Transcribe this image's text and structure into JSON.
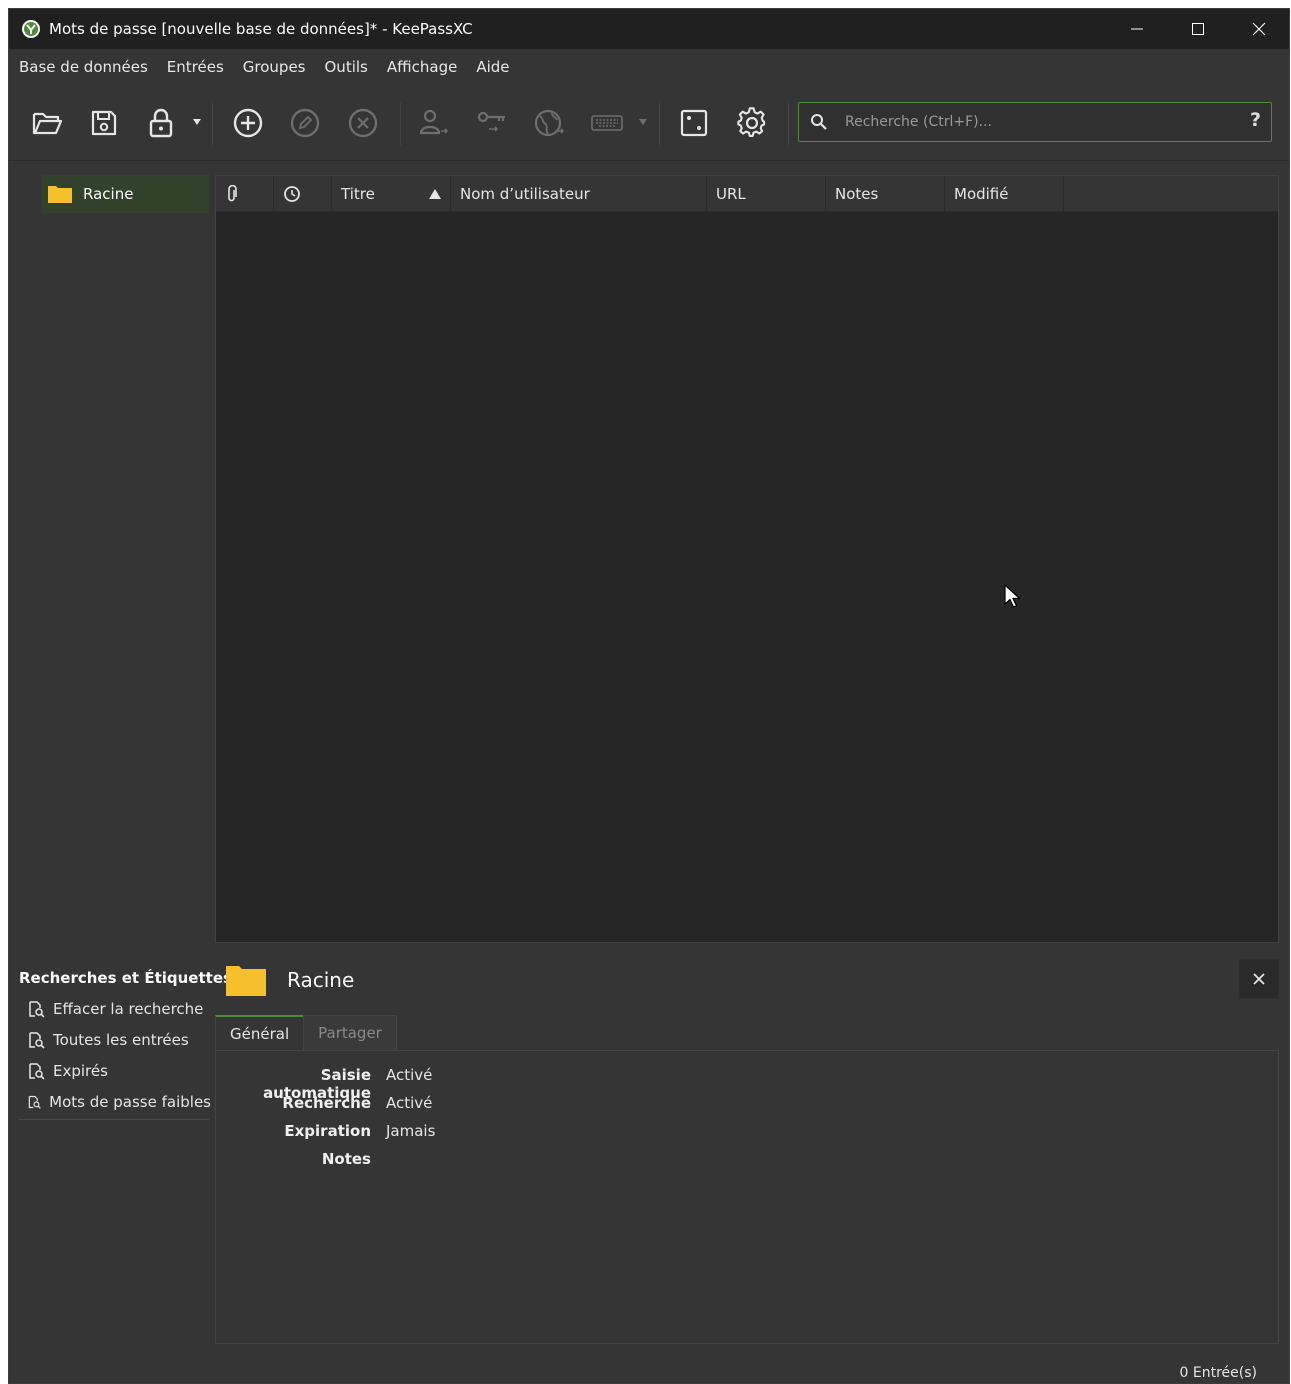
{
  "window": {
    "title": "Mots de passe [nouvelle base de données]* - KeePassXC"
  },
  "menu": [
    "Base de données",
    "Entrées",
    "Groupes",
    "Outils",
    "Affichage",
    "Aide"
  ],
  "toolbar": {
    "icons": [
      "open-database-icon",
      "save-database-icon",
      "lock-database-icon",
      "add-entry-icon",
      "edit-entry-icon",
      "delete-entry-icon",
      "copy-username-icon",
      "copy-password-icon",
      "copy-url-icon",
      "auto-type-icon",
      "password-generator-icon",
      "settings-icon"
    ],
    "search": {
      "placeholder": "Recherche (Ctrl+F)...",
      "value": "",
      "help_label": "?"
    }
  },
  "group_tree": {
    "items": [
      {
        "label": "Racine",
        "icon": "folder-icon",
        "selected": true
      }
    ]
  },
  "entry_table": {
    "columns": [
      "Titre",
      "Nom d’utilisateur",
      "URL",
      "Notes",
      "Modifié"
    ],
    "icon_columns": [
      "paperclip-icon",
      "clock-icon"
    ],
    "sorted_column": "Titre",
    "sort_direction": "ascending",
    "rows": []
  },
  "searches_panel": {
    "title": "Recherches et Étiquettes",
    "items": [
      "Effacer la recherche",
      "Toutes les entrées",
      "Expirés",
      "Mots de passe faibles"
    ]
  },
  "group_details": {
    "title": "Racine",
    "tabs": [
      {
        "label": "Général",
        "active": true
      },
      {
        "label": "Partager",
        "active": false
      }
    ],
    "properties": [
      {
        "label": "Saisie automatique",
        "value": "Activé"
      },
      {
        "label": "Recherche",
        "value": "Activé"
      },
      {
        "label": "Expiration",
        "value": "Jamais"
      },
      {
        "label": "Notes",
        "value": ""
      }
    ]
  },
  "status": {
    "entry_count": "0 Entrée(s)"
  },
  "colors": {
    "accent": "#4e8a3a",
    "folder": "#f6c02c",
    "background": "#353535",
    "table_bg": "#262626"
  }
}
